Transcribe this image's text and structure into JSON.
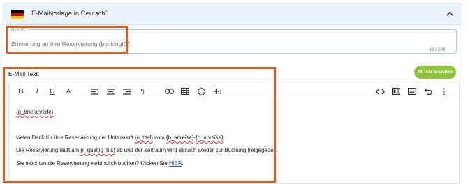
{
  "header": {
    "title": "E-Mailvorlage in Deutsch",
    "title_suffix": "ˇ",
    "flag_colors": [
      "#000000",
      "#dd0000",
      "#ffce00"
    ]
  },
  "subject": {
    "label": "Betreff *",
    "value": "Erinnerung an Ihre Reservierung {bookingID}",
    "counter": "43 / 200"
  },
  "body": {
    "label": "E-Mail Text:",
    "ai_button": "KI Text erstellen"
  },
  "editor": {
    "line1": "{g_briefanrede}",
    "line2_a": "vielen Dank für Ihre Reservierung der Unterkunft ",
    "line2_ph1": "{u_titel}",
    "line2_b": " vom ",
    "line2_ph2": "{b_anreise}",
    "line2_c": "-",
    "line2_ph3": "{b_abreise}",
    "line2_d": ".",
    "line3_a": "Die Reservierung läuft am ",
    "line3_ph": "{r_gueltig_bis}",
    "line3_b": " ab und der Zeitraum wird danach wieder zur Buchung freigegeben.",
    "line4_a": "Sie möchten die Reservierung verbindlich buchen? Klicken Sie ",
    "line4_link": "HIER",
    "line4_b": "."
  },
  "colors": {
    "highlight": "#e35a1f",
    "ai_button": "#8fc53d",
    "link": "#2a4fd6"
  }
}
